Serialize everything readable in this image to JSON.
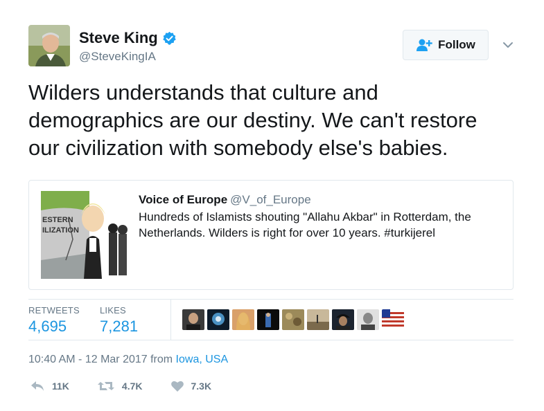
{
  "author": {
    "name": "Steve King",
    "handle": "@SteveKingIA",
    "verified": true
  },
  "follow_button": {
    "label": "Follow",
    "icon": "add-user-icon"
  },
  "tweet": {
    "lines": [
      "Wilders understands that culture and",
      "demographics are our destiny. We can't restore",
      "our civilization with somebody else's babies."
    ]
  },
  "quoted_tweet": {
    "name": "Voice of Europe",
    "handle": "@V_of_Europe",
    "lines": [
      "Hundreds of Islamists shouting \"Allahu Akbar\" in Rotterdam, the",
      "Netherlands. Wilders is right for over 10 years. #turkijerel"
    ],
    "image_text": [
      "ESTERN",
      "ILIZATION"
    ]
  },
  "stats": {
    "retweets_label": "RETWEETS",
    "retweets_value": "4,695",
    "likes_label": "LIKES",
    "likes_value": "7,281"
  },
  "likers_count": 9,
  "meta": {
    "time": "10:40 AM - 12 Mar 2017 from ",
    "location": "Iowa, USA"
  },
  "actions": {
    "reply": {
      "icon": "reply-icon",
      "count": "11K"
    },
    "retweet": {
      "icon": "retweet-icon",
      "count": "4.7K"
    },
    "like": {
      "icon": "heart-icon",
      "count": "7.3K"
    }
  },
  "colors": {
    "accent": "#1b95e0",
    "muted": "#657786",
    "border": "#e1e8ed",
    "verified": "#1da1f2"
  }
}
